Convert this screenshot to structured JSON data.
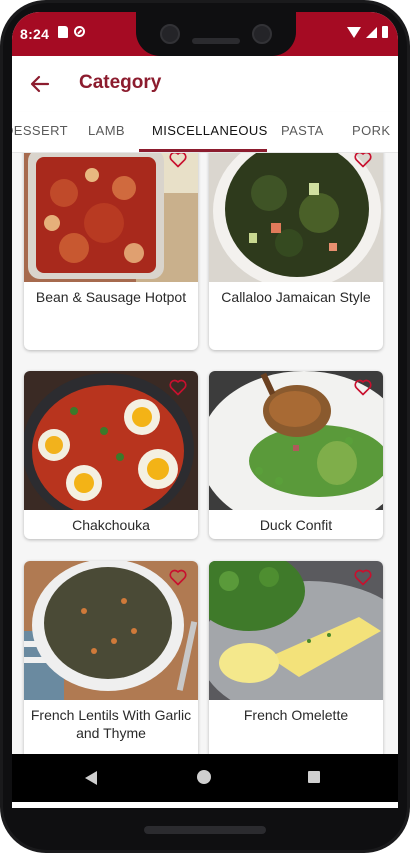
{
  "status_bar": {
    "time": "8:24"
  },
  "app_bar": {
    "title": "Category"
  },
  "tabs": [
    {
      "label": "DESSERT"
    },
    {
      "label": "LAMB"
    },
    {
      "label": "MISCELLANEOUS",
      "active": true
    },
    {
      "label": "PASTA"
    },
    {
      "label": "PORK"
    }
  ],
  "recipes": [
    {
      "name": "Bean & Sausage Hotpot",
      "favorite": false
    },
    {
      "name": "Callaloo Jamaican Style",
      "favorite": false
    },
    {
      "name": "Chakchouka",
      "favorite": false
    },
    {
      "name": "Duck Confit",
      "favorite": false
    },
    {
      "name": "French Lentils With Garlic and Thyme",
      "favorite": false
    },
    {
      "name": "French Omelette",
      "favorite": false
    }
  ],
  "colors": {
    "status_bar": "#a50b23",
    "accent": "#8c1c2e",
    "heart": "#c8102e"
  },
  "icons": {
    "back": "arrow-left-icon",
    "favorite": "heart-outline-icon"
  }
}
